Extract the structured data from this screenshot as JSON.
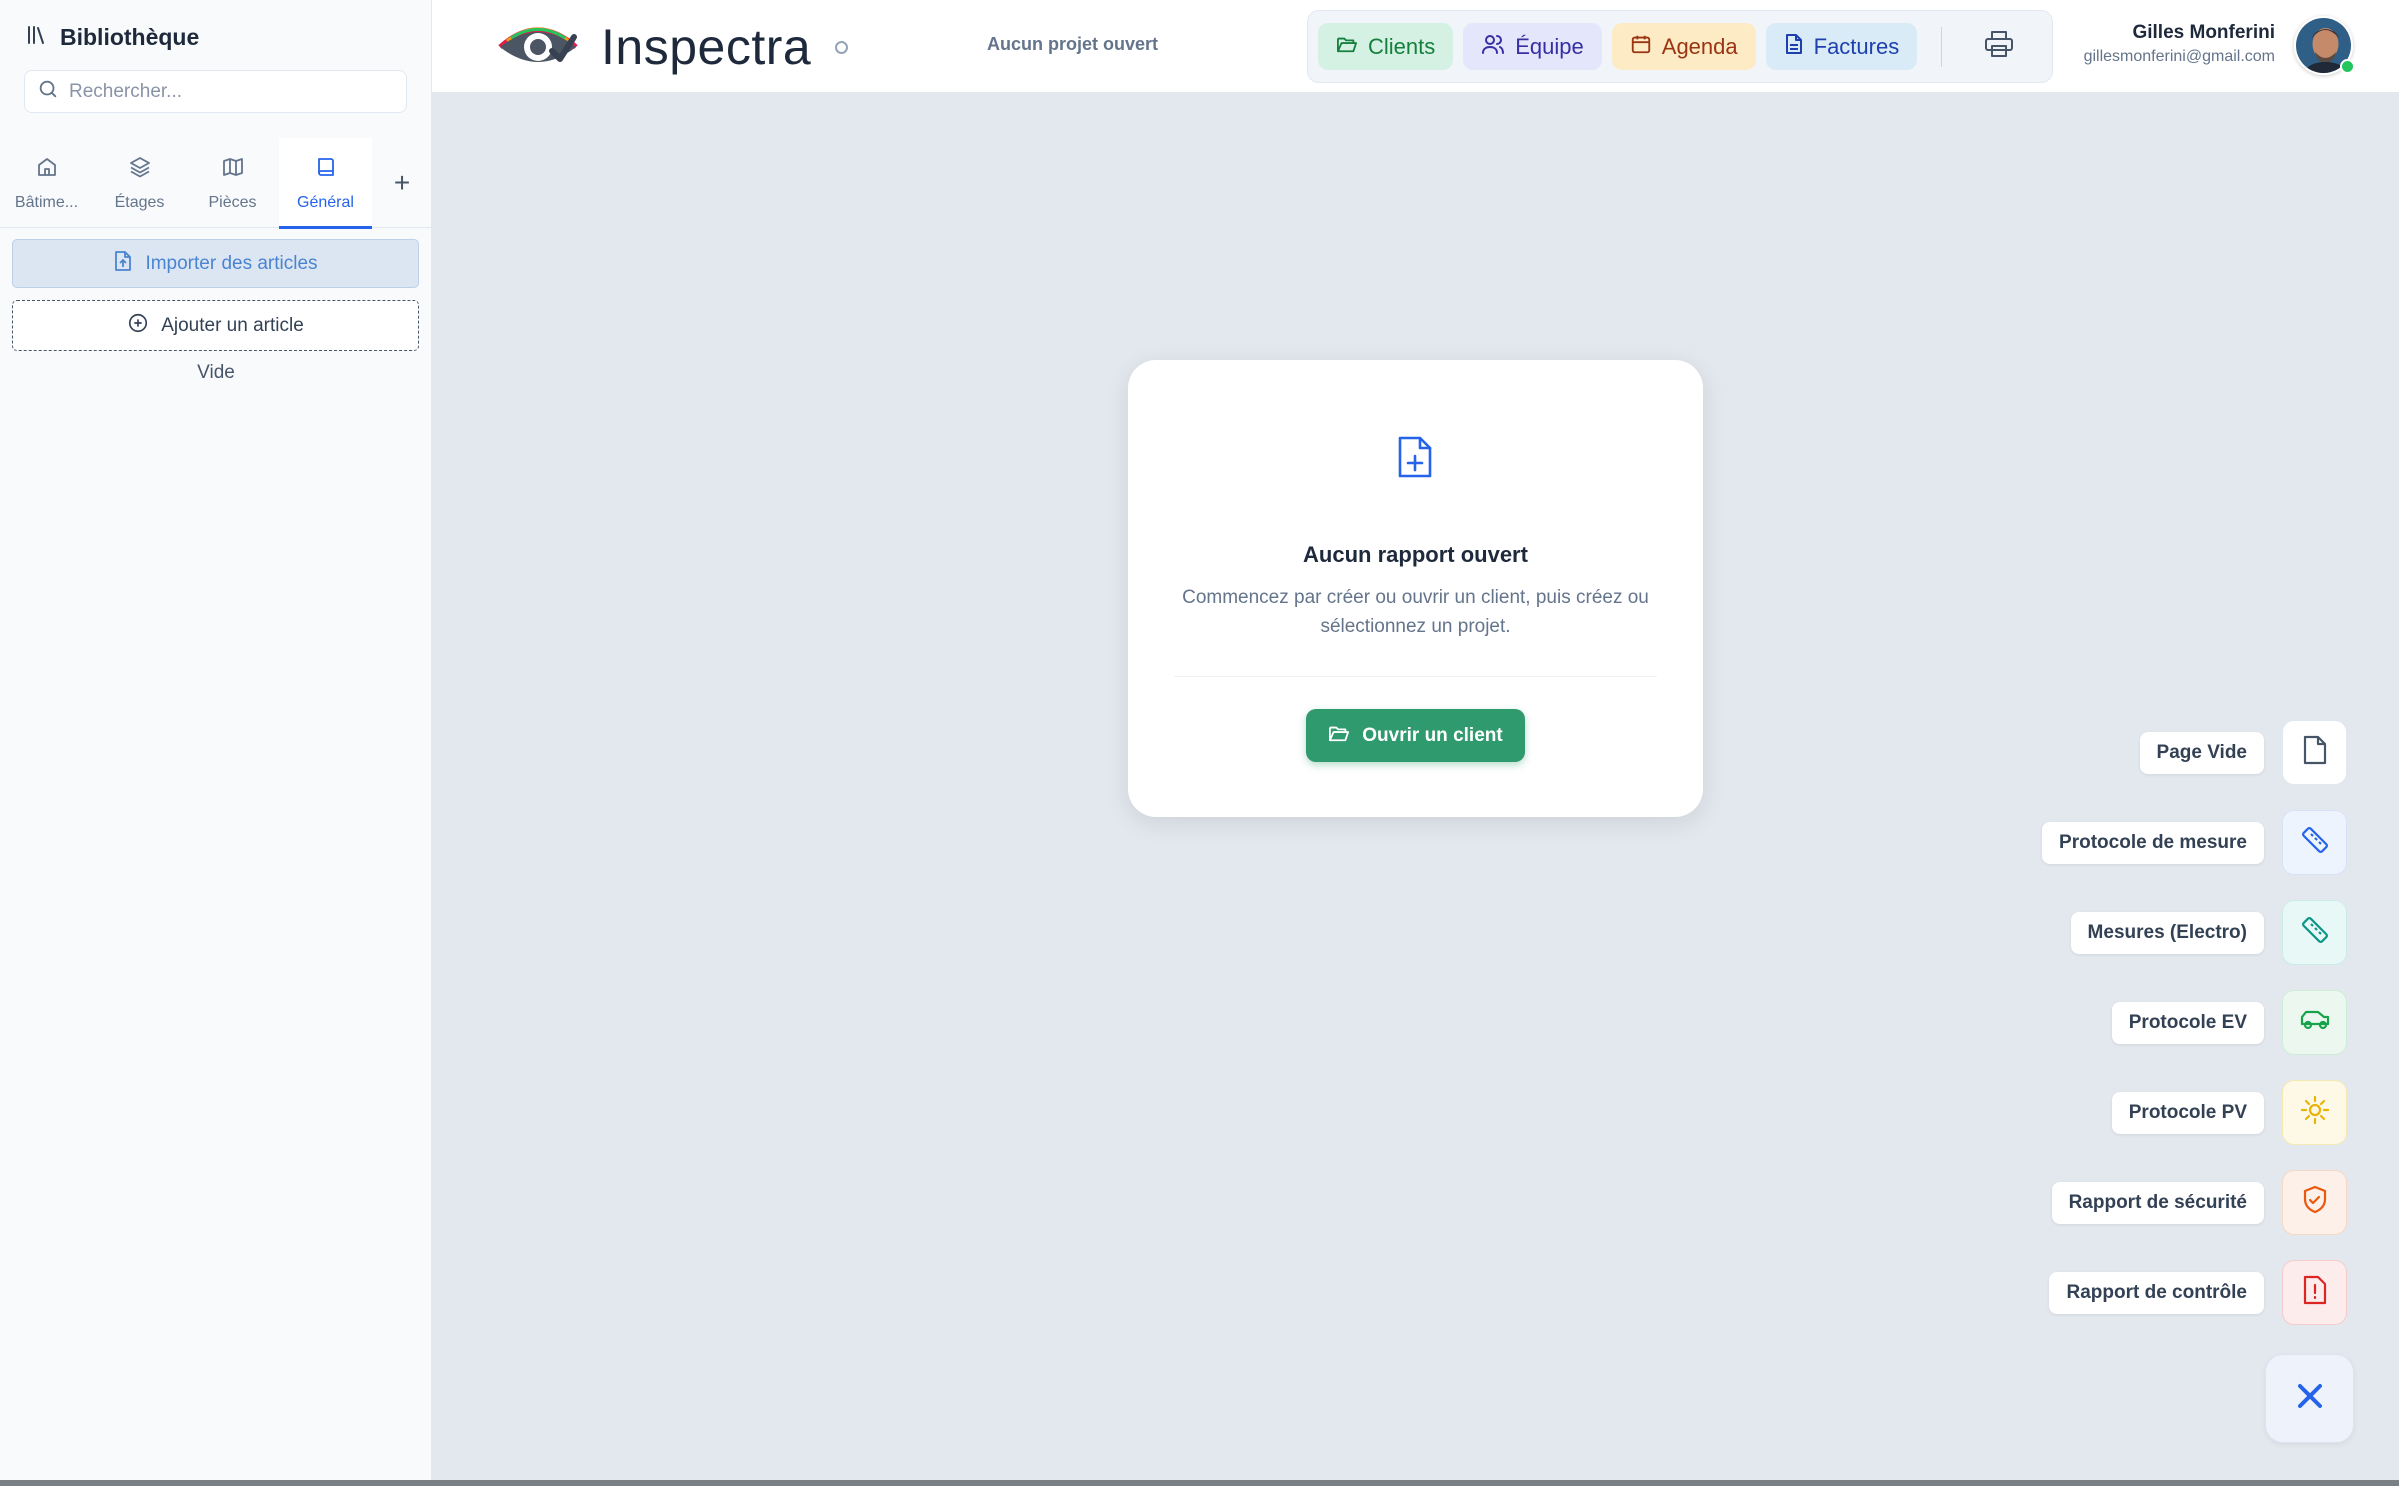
{
  "sidebar": {
    "title": "Bibliothèque",
    "search_placeholder": "Rechercher...",
    "tabs": [
      {
        "label": "Bâtime...",
        "icon": "home-icon"
      },
      {
        "label": "Étages",
        "icon": "layers-icon"
      },
      {
        "label": "Pièces",
        "icon": "map-icon"
      },
      {
        "label": "Général",
        "icon": "book-icon",
        "active": true
      }
    ],
    "add_tab": "+",
    "import_label": "Importer des articles",
    "add_label": "Ajouter un article",
    "empty_label": "Vide"
  },
  "header": {
    "app_name": "Inspectra",
    "project_status": "Aucun projet ouvert",
    "nav": [
      {
        "label": "Clients",
        "icon": "folder-open-icon",
        "bg": "#d5f1e3",
        "color": "#15803d"
      },
      {
        "label": "Équipe",
        "icon": "users-icon",
        "bg": "#e4e6fb",
        "color": "#3730a3"
      },
      {
        "label": "Agenda",
        "icon": "calendar-icon",
        "bg": "#fcebc5",
        "color": "#9a3412"
      },
      {
        "label": "Factures",
        "icon": "file-text-icon",
        "bg": "#d9ebf7",
        "color": "#1e40af"
      }
    ],
    "user": {
      "name": "Gilles Monferini",
      "email": "gillesmonferini@gmail.com"
    }
  },
  "empty_state": {
    "title": "Aucun rapport ouvert",
    "description": "Commencez par créer ou ouvrir un client, puis créez ou sélectionnez un projet.",
    "button": "Ouvrir un client"
  },
  "fab_menu": {
    "items": [
      {
        "label": "Page Vide",
        "icon": "file-icon",
        "color": "#475569",
        "bg": "#ffffff",
        "border": "#e2e8f0"
      },
      {
        "label": "Protocole de mesure",
        "icon": "ruler-icon",
        "color": "#2563eb",
        "bg": "#eef4fd",
        "border": "#d6e3f7"
      },
      {
        "label": "Mesures (Electro)",
        "icon": "ruler-icon",
        "color": "#0d9488",
        "bg": "#e8f8f7",
        "border": "#c9ece8"
      },
      {
        "label": "Protocole EV",
        "icon": "car-icon",
        "color": "#16a34a",
        "bg": "#ecf8ef",
        "border": "#cdeed6"
      },
      {
        "label": "Protocole PV",
        "icon": "sun-icon",
        "color": "#eab308",
        "bg": "#fdf9e6",
        "border": "#f5e9b3"
      },
      {
        "label": "Rapport de sécurité",
        "icon": "shield-check-icon",
        "color": "#ea580c",
        "bg": "#fdf0e8",
        "border": "#f6d8c4"
      },
      {
        "label": "Rapport de contrôle",
        "icon": "file-alert-icon",
        "color": "#dc2626",
        "bg": "#fdecec",
        "border": "#f4cccc"
      }
    ],
    "close_icon": "close-icon"
  }
}
